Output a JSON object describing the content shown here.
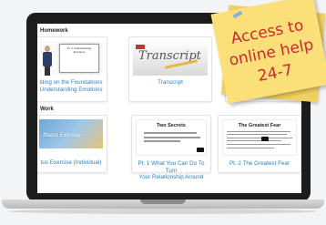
{
  "homework": {
    "section_title": "Homework",
    "cards": [
      {
        "caption": "lding on the Foundations\nUnderstanding Emotions",
        "slide_text": "Pt. 2 Understanding Emotions"
      },
      {
        "caption": "Transcript",
        "thumb_word": "Transcript"
      }
    ]
  },
  "work": {
    "section_title": "Work",
    "cards": [
      {
        "caption": "tus Exercise (Individual)",
        "thumb_text": "Status Exercise"
      },
      {
        "caption": "Pt. 1 What You Can Do To Turn\nYour Relationship Around",
        "thumb_title": "Two Secrets"
      },
      {
        "caption": "Pt. 2 The Greatest Fear",
        "thumb_title": "The Greatest Fear"
      }
    ]
  },
  "sticky_note": {
    "lines": [
      "Access to",
      "online help",
      "24-7"
    ],
    "color": "#fbe07a",
    "text_color": "#d2272d"
  },
  "colors": {
    "link": "#2f7fc1",
    "bezel": "#1c1c1c"
  }
}
